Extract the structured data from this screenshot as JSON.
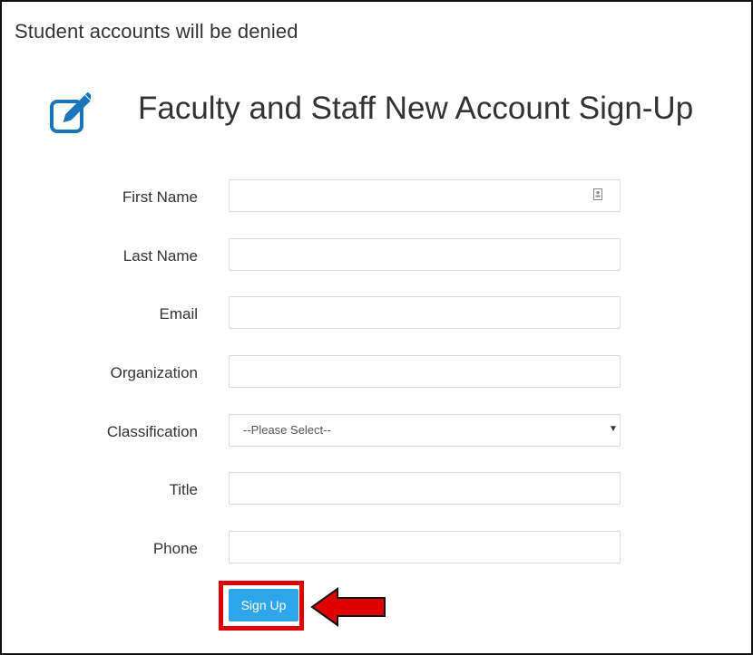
{
  "notice": "Student accounts will be denied",
  "page_title": "Faculty and Staff New Account Sign-Up",
  "form": {
    "first_name": {
      "label": "First Name",
      "value": ""
    },
    "last_name": {
      "label": "Last Name",
      "value": ""
    },
    "email": {
      "label": "Email",
      "value": ""
    },
    "organization": {
      "label": "Organization",
      "value": ""
    },
    "classification": {
      "label": "Classification",
      "selected": "--Please Select--"
    },
    "title": {
      "label": "Title",
      "value": ""
    },
    "phone": {
      "label": "Phone",
      "value": ""
    }
  },
  "signup_button": "Sign Up",
  "icons": {
    "title": "edit-icon",
    "autofill": "contact-card-icon",
    "annotation": "arrow-left-icon",
    "dropdown": "caret-down-icon"
  },
  "colors": {
    "accent": "#2ea6ec",
    "icon_blue": "#1b75bb",
    "annotation_red": "#e00000"
  }
}
